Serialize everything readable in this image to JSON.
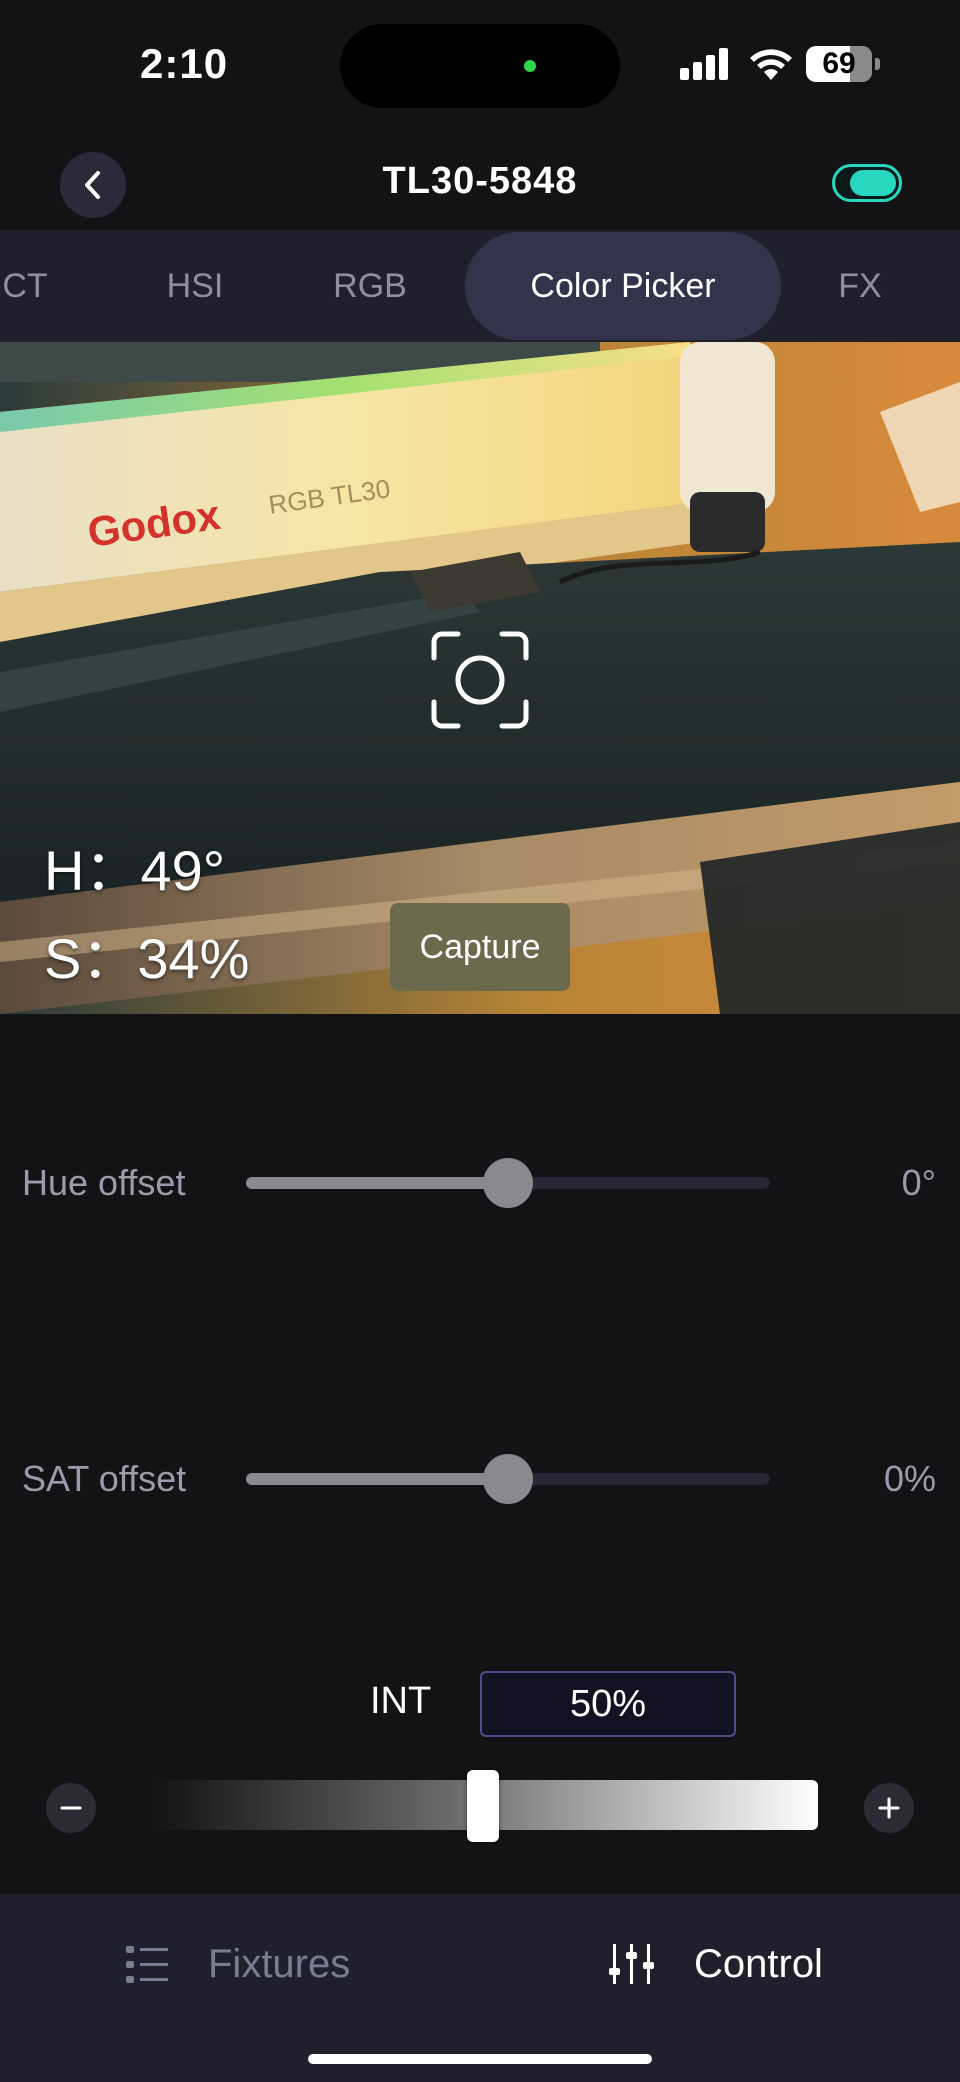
{
  "status_bar": {
    "time": "2:10",
    "battery": "69"
  },
  "header": {
    "title": "TL30-5848",
    "power_on": true
  },
  "tabs": [
    {
      "label": "CT",
      "active": false
    },
    {
      "label": "HSI",
      "active": false
    },
    {
      "label": "RGB",
      "active": false
    },
    {
      "label": "Color Picker",
      "active": true
    },
    {
      "label": "FX",
      "active": false
    }
  ],
  "preview": {
    "hue_label": "H：",
    "hue_value": "49°",
    "sat_label": "S：",
    "sat_value": "34%",
    "capture_label": "Capture",
    "brand_text": "Godox",
    "product_text": "RGB TL30"
  },
  "hue_offset": {
    "label": "Hue offset",
    "value_text": "0°",
    "fraction": 0.5
  },
  "sat_offset": {
    "label": "SAT offset",
    "value_text": "0%",
    "fraction": 0.5
  },
  "intensity": {
    "label": "INT",
    "value_text": "50%",
    "fraction": 0.5
  },
  "bottom_nav": {
    "fixtures_label": "Fixtures",
    "control_label": "Control",
    "active": "control"
  },
  "colors": {
    "accent": "#27d7c0",
    "tab_active": "#33344c",
    "capture": "#6b6a4c"
  }
}
